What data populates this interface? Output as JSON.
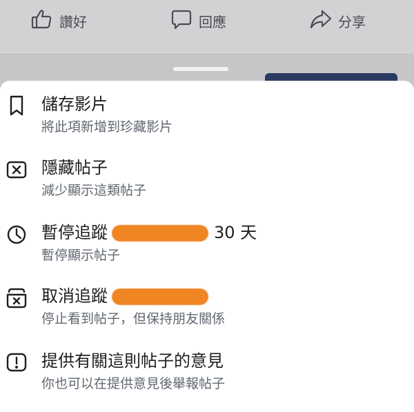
{
  "action_bar": {
    "like_label": "讚好",
    "comment_label": "回應",
    "share_label": "分享",
    "icons": [
      "thumbs-up-icon",
      "speech-bubble-icon",
      "share-arrow-icon"
    ]
  },
  "menu": {
    "items": [
      {
        "title": "儲存影片",
        "subtitle": "將此項新增到珍藏影片",
        "icon": "bookmark-icon"
      },
      {
        "title": "隱藏帖子",
        "subtitle": "減少顯示這類帖子",
        "icon": "hide-x-icon"
      },
      {
        "title": "暫停追蹤",
        "title_suffix": "30 天",
        "subtitle": "暫停顯示帖子",
        "icon": "clock-icon",
        "redacted": true
      },
      {
        "title": "取消追蹤",
        "subtitle": "停止看到帖子，但保持朋友關係",
        "icon": "unfollow-icon",
        "redacted": true
      },
      {
        "title": "提供有關這則帖子的意見",
        "subtitle": "你也可以在提供意見後舉報帖子",
        "icon": "feedback-exclamation-icon"
      }
    ]
  },
  "colors": {
    "redaction": "#f08524",
    "sheet_bg": "#ffffff",
    "backdrop": "#c6c6c8",
    "accent_button": "#2b3a63"
  }
}
